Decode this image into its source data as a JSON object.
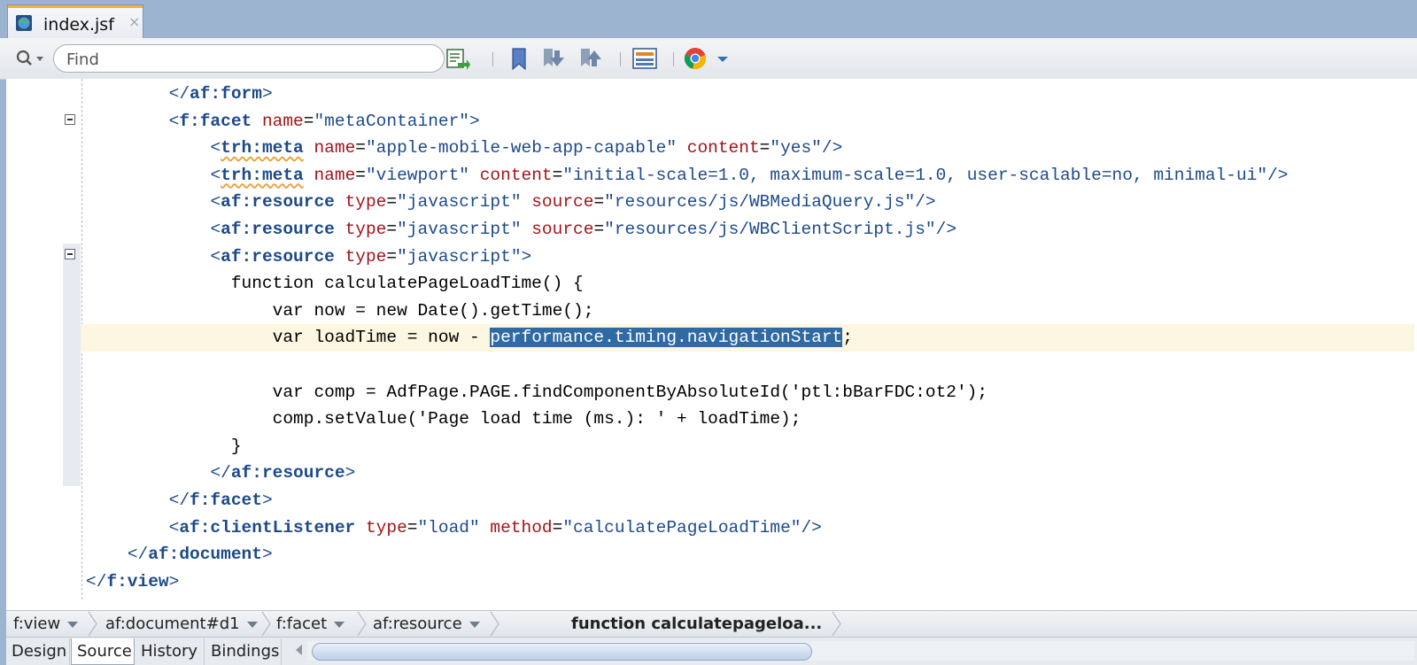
{
  "tab": {
    "label": "index.jsf",
    "close": "×"
  },
  "toolbar": {
    "find_placeholder": "Find"
  },
  "code": {
    "lines": [
      {
        "indent": "        ",
        "tokens": [
          [
            "bracket",
            "</"
          ],
          [
            "tag",
            "af:form"
          ],
          [
            "bracket",
            ">"
          ]
        ]
      },
      {
        "indent": "        ",
        "tokens": [
          [
            "bracket",
            "<"
          ],
          [
            "tag",
            "f:facet"
          ],
          [
            "plain",
            " "
          ],
          [
            "attr",
            "name"
          ],
          [
            "plain",
            "="
          ],
          [
            "val",
            "\"metaContainer\""
          ],
          [
            "bracket",
            ">"
          ]
        ]
      },
      {
        "indent": "            ",
        "tokens": [
          [
            "bracket",
            "<"
          ],
          [
            "tagsq",
            "trh:meta"
          ],
          [
            "plain",
            " "
          ],
          [
            "attr",
            "name"
          ],
          [
            "plain",
            "="
          ],
          [
            "val",
            "\"apple-mobile-web-app-capable\""
          ],
          [
            "plain",
            " "
          ],
          [
            "attr",
            "content"
          ],
          [
            "plain",
            "="
          ],
          [
            "val",
            "\"yes\""
          ],
          [
            "bracket",
            "/>"
          ]
        ]
      },
      {
        "indent": "            ",
        "tokens": [
          [
            "bracket",
            "<"
          ],
          [
            "tagsq",
            "trh:meta"
          ],
          [
            "plain",
            " "
          ],
          [
            "attr",
            "name"
          ],
          [
            "plain",
            "="
          ],
          [
            "val",
            "\"viewport\""
          ],
          [
            "plain",
            " "
          ],
          [
            "attr",
            "content"
          ],
          [
            "plain",
            "="
          ],
          [
            "val",
            "\"initial-scale=1.0, maximum-scale=1.0, user-scalable=no, minimal-ui\""
          ],
          [
            "bracket",
            "/>"
          ]
        ]
      },
      {
        "indent": "            ",
        "tokens": [
          [
            "bracket",
            "<"
          ],
          [
            "tag",
            "af:resource"
          ],
          [
            "plain",
            " "
          ],
          [
            "attr",
            "type"
          ],
          [
            "plain",
            "="
          ],
          [
            "val",
            "\"javascript\""
          ],
          [
            "plain",
            " "
          ],
          [
            "attr",
            "source"
          ],
          [
            "plain",
            "="
          ],
          [
            "val",
            "\"resources/js/WBMediaQuery.js\""
          ],
          [
            "bracket",
            "/>"
          ]
        ]
      },
      {
        "indent": "            ",
        "tokens": [
          [
            "bracket",
            "<"
          ],
          [
            "tag",
            "af:resource"
          ],
          [
            "plain",
            " "
          ],
          [
            "attr",
            "type"
          ],
          [
            "plain",
            "="
          ],
          [
            "val",
            "\"javascript\""
          ],
          [
            "plain",
            " "
          ],
          [
            "attr",
            "source"
          ],
          [
            "plain",
            "="
          ],
          [
            "val",
            "\"resources/js/WBClientScript.js\""
          ],
          [
            "bracket",
            "/>"
          ]
        ]
      },
      {
        "indent": "            ",
        "tokens": [
          [
            "bracket",
            "<"
          ],
          [
            "tag",
            "af:resource"
          ],
          [
            "plain",
            " "
          ],
          [
            "attr",
            "type"
          ],
          [
            "plain",
            "="
          ],
          [
            "val",
            "\"javascript\""
          ],
          [
            "bracket",
            ">"
          ]
        ]
      },
      {
        "indent": "              ",
        "tokens": [
          [
            "plain",
            "function calculatePageLoadTime() {"
          ]
        ]
      },
      {
        "indent": "                  ",
        "tokens": [
          [
            "plain",
            "var now = new Date().getTime();"
          ]
        ]
      },
      {
        "indent": "                  ",
        "current": true,
        "tokens": [
          [
            "plain",
            "var loadTime = now - "
          ],
          [
            "sel",
            "performance.timing.navigationStart"
          ],
          [
            "plain",
            ";"
          ]
        ]
      },
      {
        "indent": "",
        "tokens": []
      },
      {
        "indent": "                  ",
        "tokens": [
          [
            "plain",
            "var comp = AdfPage.PAGE.findComponentByAbsoluteId('ptl:bBarFDC:ot2');"
          ]
        ]
      },
      {
        "indent": "                  ",
        "tokens": [
          [
            "plain",
            "comp.setValue('Page load time (ms.): ' + loadTime);"
          ]
        ]
      },
      {
        "indent": "              ",
        "tokens": [
          [
            "plain",
            "}"
          ]
        ]
      },
      {
        "indent": "            ",
        "tokens": [
          [
            "bracket",
            "</"
          ],
          [
            "tag",
            "af:resource"
          ],
          [
            "bracket",
            ">"
          ]
        ]
      },
      {
        "indent": "        ",
        "tokens": [
          [
            "bracket",
            "</"
          ],
          [
            "tag",
            "f:facet"
          ],
          [
            "bracket",
            ">"
          ]
        ]
      },
      {
        "indent": "        ",
        "tokens": [
          [
            "bracket",
            "<"
          ],
          [
            "tag",
            "af:clientListener"
          ],
          [
            "plain",
            " "
          ],
          [
            "attr",
            "type"
          ],
          [
            "plain",
            "="
          ],
          [
            "val",
            "\"load\""
          ],
          [
            "plain",
            " "
          ],
          [
            "attr",
            "method"
          ],
          [
            "plain",
            "="
          ],
          [
            "val",
            "\"calculatePageLoadTime\""
          ],
          [
            "bracket",
            "/>"
          ]
        ]
      },
      {
        "indent": "    ",
        "tokens": [
          [
            "bracket",
            "</"
          ],
          [
            "tag",
            "af:document"
          ],
          [
            "bracket",
            ">"
          ]
        ]
      },
      {
        "indent": "",
        "tokens": [
          [
            "bracket",
            "</"
          ],
          [
            "tag",
            "f:view"
          ],
          [
            "bracket",
            ">"
          ]
        ]
      }
    ]
  },
  "breadcrumbs": {
    "items": [
      "f:view",
      "af:document#d1",
      "f:facet",
      "af:resource"
    ],
    "current": "function calculatepageloa..."
  },
  "bottom_tabs": [
    "Design",
    "Source",
    "History",
    "Bindings"
  ],
  "active_bottom_tab": "Source",
  "colors": {
    "tab_accent": "#f2b233",
    "selection": "#2f6aa3",
    "current_line": "#fdf6e0",
    "tag": "#1d4a8a",
    "attribute": "#a3141a"
  }
}
